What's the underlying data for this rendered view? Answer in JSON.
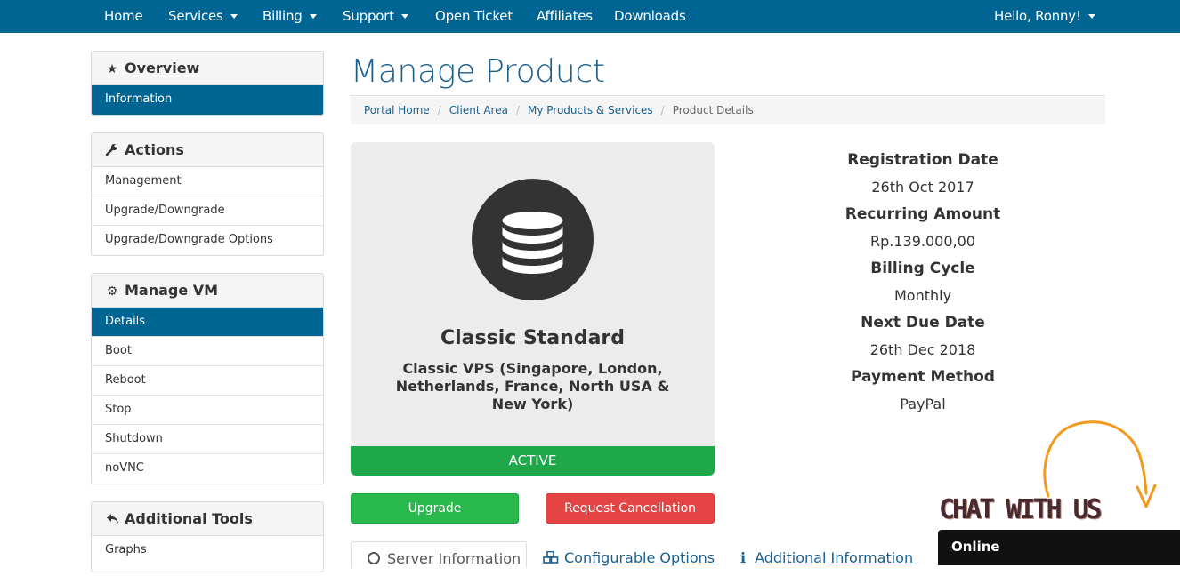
{
  "nav": {
    "home": "Home",
    "services": "Services",
    "billing": "Billing",
    "support": "Support",
    "open_ticket": "Open Ticket",
    "affiliates": "Affiliates",
    "downloads": "Downloads",
    "user": "Hello, Ronny!"
  },
  "sidebar": {
    "overview": {
      "title": "Overview",
      "icon": "star-icon",
      "items": [
        "Information"
      ]
    },
    "actions": {
      "title": "Actions",
      "icon": "wrench-icon",
      "items": [
        "Management",
        "Upgrade/Downgrade",
        "Upgrade/Downgrade Options"
      ]
    },
    "manage_vm": {
      "title": "Manage VM",
      "icon": "gear-icon",
      "items": [
        "Details",
        "Boot",
        "Reboot",
        "Stop",
        "Shutdown",
        "noVNC"
      ]
    },
    "additional_tools": {
      "title": "Additional Tools",
      "icon": "reply-icon",
      "items": [
        "Graphs"
      ]
    }
  },
  "page": {
    "title": "Manage Product",
    "breadcrumb": [
      "Portal Home",
      "Client Area",
      "My Products & Services",
      "Product Details"
    ]
  },
  "product": {
    "icon": "database-icon",
    "name": "Classic Standard",
    "group": "Classic VPS (Singapore, London, Netherlands, France, North USA & New York)",
    "status": "ACTIVE"
  },
  "details": {
    "registration_date_label": "Registration Date",
    "registration_date": "26th Oct 2017",
    "recurring_amount_label": "Recurring Amount",
    "recurring_amount": "Rp.139.000,00",
    "billing_cycle_label": "Billing Cycle",
    "billing_cycle": "Monthly",
    "next_due_date_label": "Next Due Date",
    "next_due_date": "26th Dec 2018",
    "payment_method_label": "Payment Method",
    "payment_method": "PayPal"
  },
  "actions": {
    "upgrade": "Upgrade",
    "request_cancellation": "Request Cancellation"
  },
  "tabs": [
    "Server Information",
    "Configurable Options",
    "Additional Information"
  ],
  "chat": {
    "label": "CHAT WITH US",
    "status": "Online"
  },
  "colors": {
    "nav_bg": "#006592",
    "active_item": "#006592",
    "status_green": "#1fa84a",
    "upgrade_green": "#28b84b",
    "cancel_red": "#e54444",
    "arrow_orange": "#f39a1e"
  }
}
